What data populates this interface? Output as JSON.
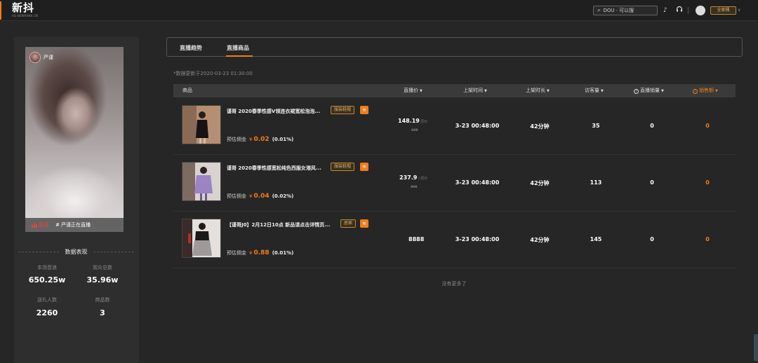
{
  "header": {
    "logo_text": "新抖",
    "logo_sub": "XD.NEWRANK.CN",
    "search_placeholder": "DOU · 可以搜",
    "version_label": "全家桶",
    "icons": [
      "tiktok-icon",
      "headset-icon",
      "user-avatar",
      "chevron-down-icon"
    ]
  },
  "streamer": {
    "name": "严谨",
    "live_label": "直播",
    "hashtag": "# 严谨正在直播"
  },
  "stats": {
    "title": "数据表现",
    "items": [
      {
        "label": "本场音浪",
        "value": "650.25w"
      },
      {
        "label": "观众总数",
        "value": "35.96w"
      },
      {
        "label": "送礼人数",
        "value": "2260"
      },
      {
        "label": "商品数",
        "value": "3"
      }
    ]
  },
  "tabs": [
    {
      "label": "直播趋势",
      "active": false
    },
    {
      "label": "直播商品",
      "active": true
    }
  ],
  "updated_note": "*数据更新于2020-03-23 01:30:00",
  "table": {
    "headers": [
      "商品",
      "直播价",
      "上架时间",
      "上架时长",
      "访客量",
      "直播销量",
      "销售额"
    ],
    "rows": [
      {
        "title": "谨哥 2020春季性感V领连衣裙宽松泡泡...",
        "tag": "服装鞋帽",
        "commission_label": "预估佣金",
        "currency": "¥",
        "commission": "0.02",
        "commission_rate": "(0.01%)",
        "price": "148.19",
        "orig_label": "/ 原价",
        "orig_price": "198",
        "listed_time": "3-23 00:48:00",
        "duration": "42分钟",
        "visitors": "35",
        "sales": "0",
        "revenue": "0"
      },
      {
        "title": "谨哥 2020春季性感宽松纯色西服女港风...",
        "tag": "服装鞋帽",
        "commission_label": "预估佣金",
        "currency": "¥",
        "commission": "0.04",
        "commission_rate": "(0.02%)",
        "price": "237.9",
        "orig_label": "/ 原价",
        "orig_price": "305",
        "listed_time": "3-23 00:48:00",
        "duration": "42分钟",
        "visitors": "113",
        "sales": "0",
        "revenue": "0"
      },
      {
        "title": "【谨哥J0】2月12日10点 新品请点击详情页...",
        "tag": "居家",
        "commission_label": "预估佣金",
        "currency": "¥",
        "commission": "0.88",
        "commission_rate": "(0.01%)",
        "price": "8888",
        "orig_label": "",
        "orig_price": "",
        "listed_time": "3-23 00:48:00",
        "duration": "42分钟",
        "visitors": "145",
        "sales": "0",
        "revenue": "0"
      }
    ]
  },
  "footer_note": "没有更多了",
  "colors": {
    "accent": "#f07d1a",
    "tag_border": "#b88a33",
    "live_red": "#e8433b"
  }
}
